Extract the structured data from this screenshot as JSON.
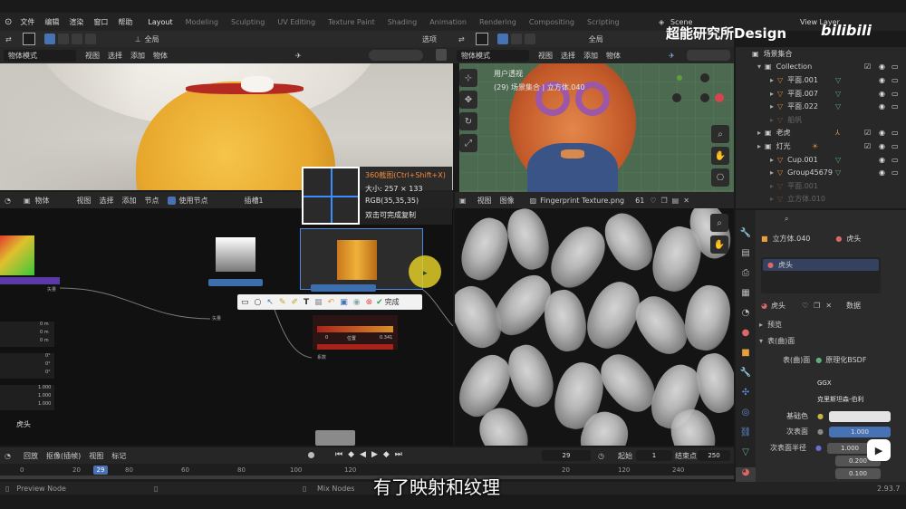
{
  "topbar": {
    "menus": [
      "文件",
      "编辑",
      "渲染",
      "窗口",
      "帮助"
    ],
    "workspaces": [
      "Layout",
      "Modeling",
      "Sculpting",
      "UV Editing",
      "Texture Paint",
      "Shading",
      "Animation",
      "Rendering",
      "Compositing",
      "Scripting"
    ],
    "active_workspace": "Layout",
    "scene_label": "Scene",
    "view_layer_label": "View Layer"
  },
  "watermark": {
    "text": "超能研究所Design",
    "logo": "bilibili"
  },
  "viewport_left": {
    "global_label": "全局",
    "mode": "物体模式",
    "menus": [
      "视图",
      "选择",
      "添加",
      "物体"
    ]
  },
  "viewport_right": {
    "global_label": "全局",
    "options_label": "选项",
    "mode": "物体模式",
    "menus": [
      "视图",
      "选择",
      "添加",
      "物体"
    ],
    "overlay_line1": "用户透视",
    "overlay_line2": "(29) 场景集合 | 立方体.040"
  },
  "node_editor": {
    "type_label": "物体",
    "menus": [
      "视图",
      "选择",
      "添加",
      "节点"
    ],
    "use_nodes_label": "使用节点",
    "slot_label": "插槽1",
    "object_name": "虎头",
    "values_col": [
      "0 m",
      "0 m",
      "0 m",
      "0°",
      "0°",
      "0°",
      "1.000",
      "1.000",
      "1.000"
    ],
    "node_small_label": "矢量",
    "node_small_label2": "矢量",
    "node_small_label3": "系数",
    "colorramp_values": [
      "0",
      "0.341"
    ],
    "colorramp_mid": "位置"
  },
  "screenshot_tool": {
    "title": "360截图(Ctrl+Shift+X)",
    "size_label": "大小: 257 × 133",
    "rgb_label": "RGB(35,35,35)",
    "hint": "双击可完成复制",
    "done_label": "完成"
  },
  "image_editor": {
    "menus": [
      "视图",
      "图像"
    ],
    "image_name": "Fingerprint Texture.png",
    "users": "61"
  },
  "outliner": {
    "root": "场景集合",
    "items": [
      "Collection",
      "平面.001",
      "平面.007",
      "平面.022",
      "船帆",
      "老虎",
      "灯光",
      "Cup.001",
      "Group45679",
      "平面.001",
      "立方体.010"
    ]
  },
  "properties": {
    "object_name": "立方体.040",
    "material_name": "虎头",
    "slot_name": "虎头",
    "data_label": "数据",
    "preview_label": "预览",
    "surface_panel": "表(曲)面",
    "surface_label": "表(曲)面",
    "bsdf_label": "原理化BSDF",
    "distribution": "GGX",
    "subsurface_method": "克里斯坦森-伯利",
    "base_color_label": "基础色",
    "subsurface_label": "次表面",
    "subsurface_value": "1.000",
    "subsurface_radius_label": "次表面半径",
    "radius_values": [
      "1.000",
      "0.200",
      "0.100"
    ],
    "version": "2.93.7"
  },
  "timeline": {
    "menus": [
      "回放",
      "抠像(插帧)",
      "视图",
      "标记"
    ],
    "current_frame": "29",
    "start_label": "起始",
    "start_value": "1",
    "end_label": "结束点",
    "end_value": "250",
    "ticks_left": [
      "0",
      "20",
      "29",
      "80",
      "60",
      "80",
      "100",
      "120"
    ],
    "ticks_right": [
      "20",
      "120",
      "240"
    ]
  },
  "statusbar": {
    "left": "Preview Node",
    "middle": "Mix Nodes"
  },
  "subtitle": "有了映射和纹理"
}
